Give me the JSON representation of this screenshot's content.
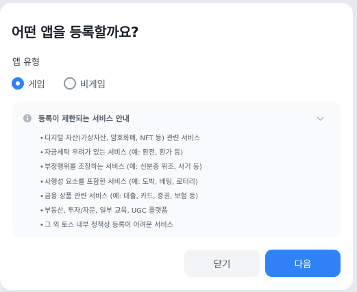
{
  "dialog": {
    "title": "어떤 앱을 등록할까요?"
  },
  "app_type": {
    "label": "앱 유형",
    "options": [
      {
        "label": "게임",
        "checked": true
      },
      {
        "label": "비게임",
        "checked": false
      }
    ]
  },
  "notice": {
    "title": "등록이 제한되는 서비스 안내",
    "expanded": true,
    "items": [
      "디지털 자산(가상자산, 암호화폐, NFT 등) 관련 서비스",
      "자금세탁 우려가 있는 서비스 (예: 환전, 환가 등)",
      "부정행위를 조장하는 서비스 (예: 신분증 위조, 사기 등)",
      "사행성 요소를 포함한 서비스 (예: 도박, 베팅, 로터리)",
      "금융 상품 관련 서비스 (예: 대출, 카드, 증권, 보험 등)",
      "부동산, 투자/자문, 일부 교육, UGC 플랫폼",
      "그 외 토스 내부 정책상 등록이 어려운 서비스"
    ]
  },
  "buttons": {
    "close_label": "닫기",
    "next_label": "다음"
  },
  "colors": {
    "accent": "#3182f6",
    "secondary_button": "#f2f4f6",
    "notice_bg": "#f9fafb"
  }
}
